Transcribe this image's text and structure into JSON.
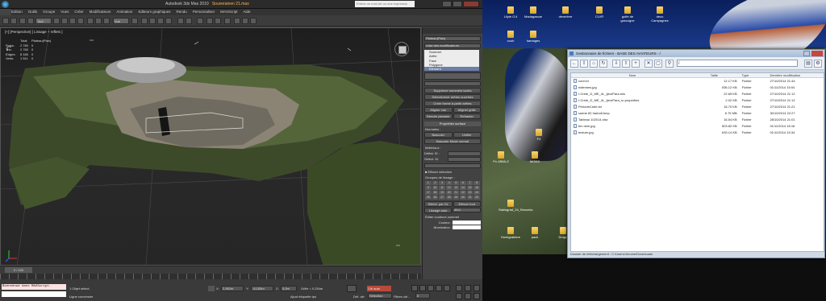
{
  "max": {
    "title_app": "Autodesk 3ds Max 2010",
    "title_file": "Souverainen 21.max",
    "search_placeholder": "Entrez un mot-clé ou une expressio",
    "menu": [
      "Edition",
      "Outils",
      "Groupe",
      "Vues",
      "Créer",
      "Modificateurs",
      "Animation",
      "Editeurs graphiques",
      "Rendu",
      "Personnaliser",
      "MAXScript",
      "Aide"
    ],
    "toolbar_select": "Tout",
    "toolbar_view": "Vue",
    "viewport_label": "[+] [Perspective] [ Lissage + reflets ]",
    "stats": {
      "header_total": "Total",
      "header_obj": "Plateau(Plan)",
      "rows": [
        {
          "k": "Polys:",
          "t": "2 780",
          "o": "0"
        },
        {
          "k": "Tris:",
          "t": "2 780",
          "o": "0"
        },
        {
          "k": "Edges:",
          "t": "8 180",
          "o": "0"
        },
        {
          "k": "Verts:",
          "t": "1 511",
          "o": "0"
        }
      ]
    },
    "timeline": "0 / 100",
    "status": {
      "maxscript": "Bienvenue dans MAXScript.",
      "selected": "1 Objet sélect.",
      "hint": "Ligne conversée",
      "x": "2,962m",
      "y": "-8,183m",
      "z": "0,0m",
      "grid": "Grille = 0,254m",
      "add_key": "Ajout étiquette tps",
      "auto_key": "Clé auto",
      "selection": "Sélection",
      "set_key": "Déf. clé",
      "filters": "Filtres clé...",
      "frame": "0"
    },
    "cmd": {
      "object_name": "Plateau(Plan)",
      "modifier_list": "Liste des modificateurs",
      "stack": [
        "Sommet",
        "Arête",
        "Face",
        "Polygone",
        "Elément"
      ],
      "stack_selected": 4,
      "buttons": [
        [
          "Supprimer sommets isolés"
        ],
        [
          "Sélectionner arêtes ouvertes"
        ],
        [
          "Créer forme à partir arêtes"
        ],
        [
          "Aligner vue",
          "Aligner grille"
        ],
        [
          "Rendre planaire",
          "Refracter"
        ]
      ],
      "surface_header": "Propriétés surface",
      "normals_label": "Normales :",
      "flip": "Basculer",
      "unify": "Unifier",
      "flip_normal_mode": "Basculer Mode normal",
      "material_label": "Matériaux :",
      "set_id": "Définir ID :",
      "select_id": "Sélect. ID",
      "clear_selection": "Effacer sélection",
      "smoothing_label": "Groupes de lissage :",
      "smoothing_numbers": [
        "1",
        "2",
        "3",
        "4",
        "5",
        "6",
        "7",
        "8",
        "9",
        "10",
        "11",
        "12",
        "13",
        "14",
        "15",
        "16",
        "17",
        "18",
        "19",
        "20",
        "21",
        "22",
        "23",
        "24",
        "25",
        "26",
        "27",
        "28",
        "29",
        "30",
        "31",
        "32"
      ],
      "select_by_sg": "Sélect. par GL",
      "clear_all": "Effacer tout",
      "autosmooth": "Lissage auto",
      "autosmooth_value": "45,0",
      "vertex_colors": "Éditer couleurs sommet",
      "color_label": "Couleur :",
      "illum_label": "Illumination :"
    }
  },
  "desktop": {
    "icons": [
      {
        "label": "Lilyte G.il"
      },
      {
        "label": "Madagascar"
      },
      {
        "label": "deverlere"
      },
      {
        "label": "CLVR"
      },
      {
        "label": "golfe de gascogne"
      },
      {
        "label": "deco Campagnes"
      },
      {
        "label": "couh"
      },
      {
        "label": "hamages"
      },
      {
        "label": "F4"
      },
      {
        "label": "Pv-1B9A-Z"
      },
      {
        "label": "MODS"
      },
      {
        "label": "Stalingrad_24_Reworks"
      },
      {
        "label": "Hochgrabiere"
      },
      {
        "label": "pack"
      },
      {
        "label": "Dropp"
      }
    ]
  },
  "filewin": {
    "title": "Gestionnaire de fichiers - BASE DES AVIATEURS - /",
    "path": "/",
    "columns": {
      "name": "Nom",
      "size": "Taille",
      "type": "Type",
      "date": "Dernière modification"
    },
    "files": [
      {
        "name": "conf.ini",
        "size": "12.17 KB",
        "type": "Fichier",
        "date": "27/10/2014 21:44"
      },
      {
        "name": "ediennes.jpg",
        "size": "536.12 KB",
        "type": "Fichier",
        "date": "01/11/2014 15:04"
      },
      {
        "name": "I-Crete_D_ME_4L_IjeurPara.mis",
        "size": "22.69 KB",
        "type": "Fichier",
        "date": "27/10/2014 21:12"
      },
      {
        "name": "I-Crete_D_ME_4L_IjeurPara_ru.properties",
        "size": "2.02 KB",
        "type": "Fichier",
        "date": "27/10/2014 21:12"
      },
      {
        "name": "PeriodeCarte.txt",
        "size": "16.70 KB",
        "type": "Fichier",
        "date": "27/10/2014 21:21"
      },
      {
        "name": "racine 82 harbolt.bmp",
        "size": "6.75 MB",
        "type": "Fichier",
        "date": "30/10/2014 22:27"
      },
      {
        "name": "Tableau 102014.xlsx",
        "size": "16.54 KB",
        "type": "Fichier",
        "date": "28/10/2014 21:01"
      },
      {
        "name": "tex dom.jpg",
        "size": "603.82 KB",
        "type": "Fichier",
        "date": "01/11/2014 16:16"
      },
      {
        "name": "texture.jpg",
        "size": "633.14 KB",
        "type": "Fichier",
        "date": "01/11/2014 15:34"
      }
    ],
    "footer": "Dossier de téléchargement : C:/Users/Jerome/Downloads"
  },
  "colors": {
    "accent": "#ffb84d",
    "autokey": "#b84a3a",
    "maxscript": "#fce2e2",
    "close": "#c9463d"
  }
}
